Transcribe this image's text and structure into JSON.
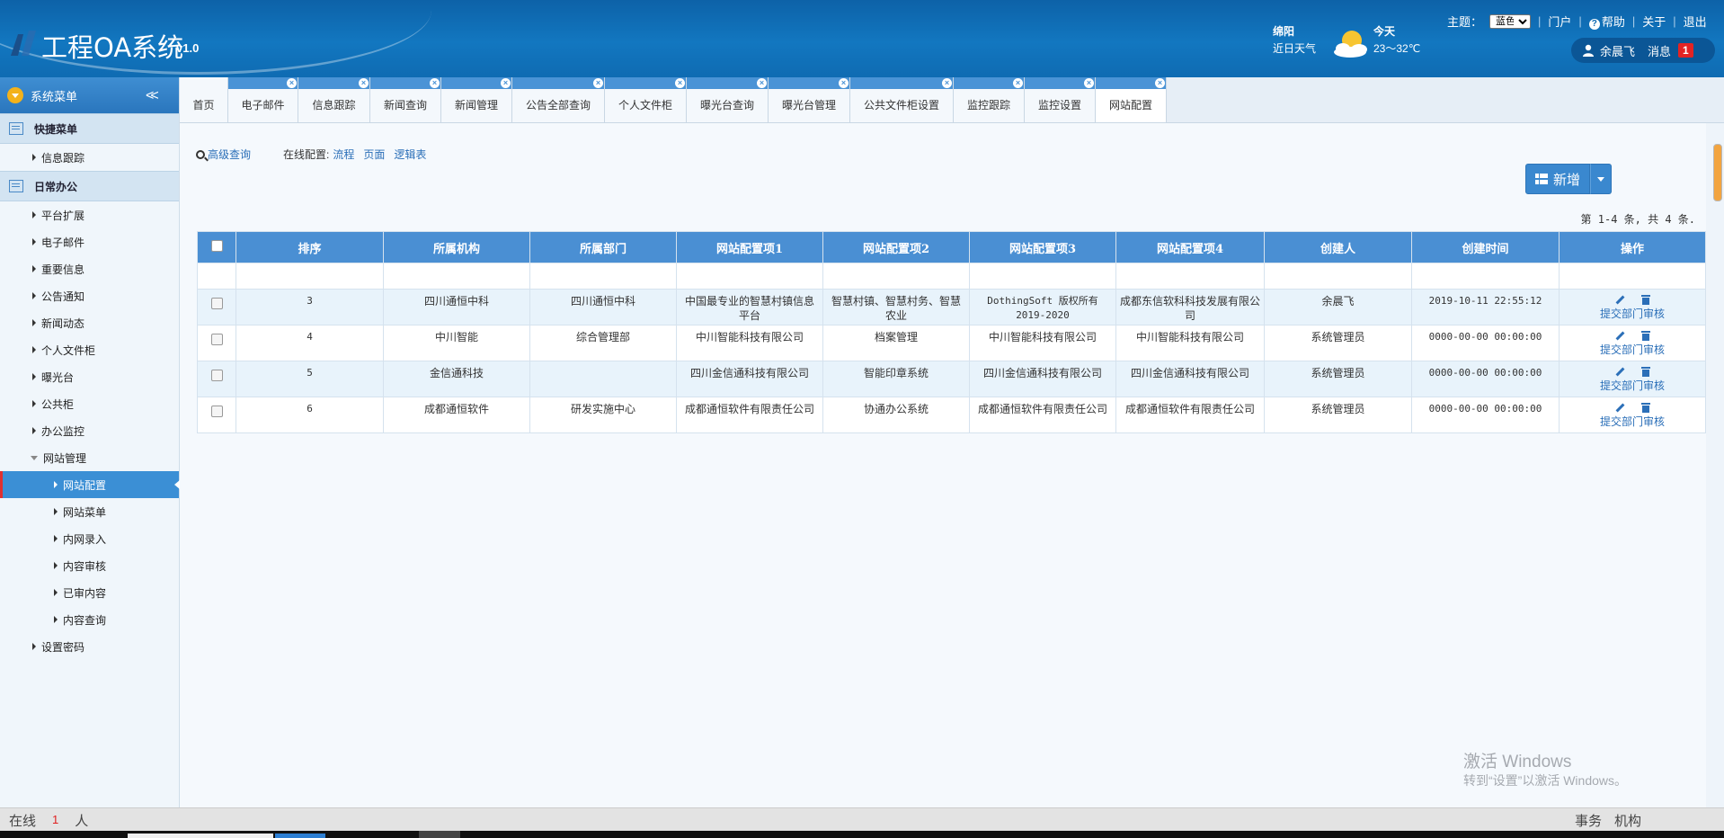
{
  "header": {
    "title": "工程OA系统",
    "version": "v1.0",
    "weather": {
      "city": "绵阳",
      "recent_label": "近日天气",
      "today_label": "今天",
      "temperature": "23～32℃"
    },
    "theme_label": "主题：",
    "theme_value": "蓝色",
    "links": {
      "portal": "门户",
      "help": "帮助",
      "about": "关于",
      "logout": "退出"
    },
    "user_name": "余晨飞",
    "message_label": "消息",
    "message_count": "1"
  },
  "sidebar": {
    "title": "系统菜单",
    "quick_group": "快捷菜单",
    "quick_items": [
      "信息跟踪"
    ],
    "daily_group": "日常办公",
    "daily_items": [
      "平台扩展",
      "电子邮件",
      "重要信息",
      "公告通知",
      "新闻动态",
      "个人文件柜",
      "曝光台",
      "公共柜",
      "办公监控"
    ],
    "website_group": "网站管理",
    "website_items": [
      "网站配置",
      "网站菜单",
      "内网录入",
      "内容审核",
      "已审内容",
      "内容查询"
    ],
    "last_item": "设置密码"
  },
  "tabs": [
    "首页",
    "电子邮件",
    "信息跟踪",
    "新闻查询",
    "新闻管理",
    "公告全部查询",
    "个人文件柜",
    "曝光台查询",
    "曝光台管理",
    "公共文件柜设置",
    "监控跟踪",
    "监控设置",
    "网站配置"
  ],
  "toolbar": {
    "advanced_search": "高级查询",
    "online_config_label": "在线配置:",
    "config_links": [
      "流程",
      "页面",
      "逻辑表"
    ],
    "add_label": "新增"
  },
  "pagination": "第 1-4 条, 共 4 条.",
  "table": {
    "columns": [
      "排序",
      "所属机构",
      "所属部门",
      "网站配置项1",
      "网站配置项2",
      "网站配置项3",
      "网站配置项4",
      "创建人",
      "创建时间",
      "操作"
    ],
    "rows": [
      [
        "3",
        "四川通恒中科",
        "四川通恒中科",
        "中国最专业的智慧村镇信息平台",
        "智慧村镇、智慧村务、智慧农业",
        "DothingSoft 版权所有 2019-2020",
        "成都东信软科科技发展有限公司",
        "余晨飞",
        "2019-10-11 22:55:12"
      ],
      [
        "4",
        "中川智能",
        "综合管理部",
        "中川智能科技有限公司",
        "档案管理",
        "中川智能科技有限公司",
        "中川智能科技有限公司",
        "系统管理员",
        "0000-00-00 00:00:00"
      ],
      [
        "5",
        "金信通科技",
        "",
        "四川金信通科技有限公司",
        "智能印章系统",
        "四川金信通科技有限公司",
        "四川金信通科技有限公司",
        "系统管理员",
        "0000-00-00 00:00:00"
      ],
      [
        "6",
        "成都通恒软件",
        "研发实施中心",
        "成都通恒软件有限责任公司",
        "协通办公系统",
        "成都通恒软件有限责任公司",
        "成都通恒软件有限责任公司",
        "系统管理员",
        "0000-00-00 00:00:00"
      ]
    ],
    "row_action": "提交部门审核"
  },
  "watermark": {
    "line1": "激活 Windows",
    "line2": "转到“设置”以激活 Windows。"
  },
  "statusbar": {
    "online_label": "在线",
    "online_count": "1",
    "online_unit": "人",
    "affairs": "事务",
    "org": "机构"
  },
  "icons": [
    "logo-icon",
    "weather-sun-cloud-icon",
    "help-icon",
    "user-icon",
    "search-icon",
    "grid-icon",
    "pencil-icon",
    "trash-icon",
    "tab-close-icon",
    "collapse-icon"
  ],
  "colors": {
    "header_blue": "#1277c0",
    "accent_blue": "#4a8fd3",
    "active_item": "#3b8fd5",
    "badge_red": "#e42323"
  }
}
